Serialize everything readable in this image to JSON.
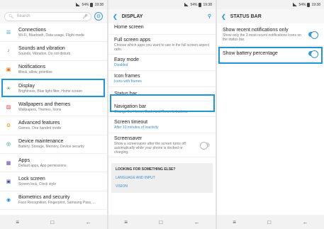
{
  "status": {
    "battery": "54%",
    "time": "19:38"
  },
  "panel1": {
    "search_placeholder": "Search",
    "items": [
      {
        "title": "Connections",
        "sub": "Wi-Fi, Bluetooth, Data usage, Flight mode",
        "icon": "connections-icon",
        "color": "#1e88e5"
      },
      {
        "title": "Sounds and vibration",
        "sub": "Sounds, Vibration, Do not disturb",
        "icon": "sound-icon",
        "color": "#7e57c2"
      },
      {
        "title": "Notifications",
        "sub": "Block, allow, prioritise",
        "icon": "notifications-icon",
        "color": "#ef6c00"
      },
      {
        "title": "Display",
        "sub": "Brightness, Blue light filter, Home screen",
        "icon": "display-icon",
        "color": "#43a047"
      },
      {
        "title": "Wallpapers and themes",
        "sub": "Wallpapers, Themes, Icons",
        "icon": "wallpaper-icon",
        "color": "#e53935"
      },
      {
        "title": "Advanced features",
        "sub": "Games, One handed mode",
        "icon": "advanced-icon",
        "color": "#fb8c00"
      },
      {
        "title": "Device maintenance",
        "sub": "Battery, Storage, Memory, Device security",
        "icon": "maintenance-icon",
        "color": "#00897b"
      },
      {
        "title": "Apps",
        "sub": "Default apps, App permissions",
        "icon": "apps-icon",
        "color": "#5e35b1"
      },
      {
        "title": "Lock screen",
        "sub": "Screen lock, Clock style",
        "icon": "lock-icon",
        "color": "#3949ab"
      },
      {
        "title": "Biometrics and security",
        "sub": "Face Recognition, Fingerprint, Samsung Pass, ...",
        "icon": "biometrics-icon",
        "color": "#1e88e5"
      }
    ]
  },
  "panel2": {
    "title": "DISPLAY",
    "items": [
      {
        "title": "Home screen",
        "sub": ""
      },
      {
        "title": "Full screen apps",
        "sub": "Choose which apps you want to use in the full screen aspect ratio."
      },
      {
        "title": "Easy mode",
        "sub_blue": "Disabled"
      },
      {
        "title": "Icon frames",
        "sub_blue": "Icons with frames"
      },
      {
        "title": "Status bar",
        "sub": ""
      },
      {
        "title": "Navigation bar",
        "sub": "Change the Home, Back, and Recents buttons."
      },
      {
        "title": "Screen timeout",
        "sub_blue": "After 10 minutes of inactivity"
      },
      {
        "title": "Screensaver",
        "sub": "Show a screensaver after the screen turns off automatically while your phone is docked or charging."
      }
    ],
    "looking": {
      "header": "LOOKING FOR SOMETHING ELSE?",
      "link1": "LANGUAGE AND INPUT",
      "link2": "VISION"
    }
  },
  "panel3": {
    "title": "STATUS BAR",
    "items": [
      {
        "title": "Show recent notifications only",
        "sub": "Show only the 3 most recent notifications icons on the status bar."
      },
      {
        "title": "Show battery percentage",
        "sub": ""
      }
    ]
  }
}
